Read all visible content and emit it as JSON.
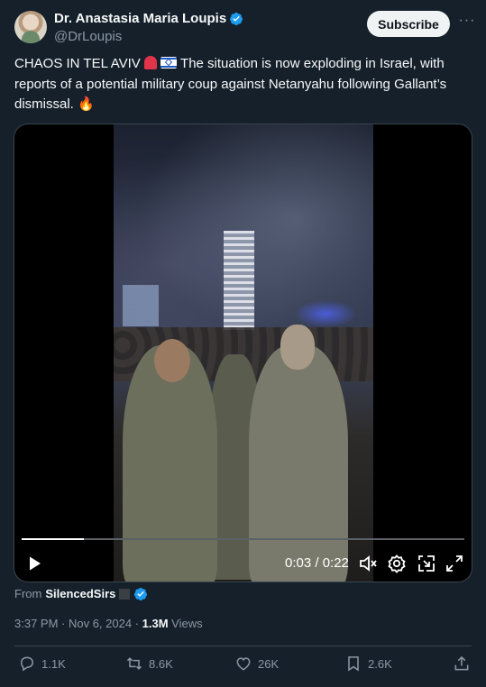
{
  "author": {
    "display_name": "Dr. Anastasia Maria Loupis",
    "handle": "@DrLoupis",
    "verified": true
  },
  "header": {
    "subscribe_label": "Subscribe",
    "more_label": "···"
  },
  "tweet": {
    "text_part1": "CHAOS IN TEL AVIV",
    "text_part2": "The situation is now exploding in Israel, with reports of a potential military coup against Netanyahu following Gallant’s dismissal.",
    "emoji_fire": "🔥"
  },
  "video": {
    "time_label": "0:03 / 0:22",
    "progress": 0.14
  },
  "attribution": {
    "prefix": "From",
    "source": "SilencedSirs"
  },
  "meta": {
    "timestamp": "3:37 PM · Nov 6, 2024 · ",
    "views_count": "1.3M",
    "views_label": " Views"
  },
  "actions": {
    "replies": "1.1K",
    "reposts": "8.6K",
    "likes": "26K",
    "bookmarks": "2.6K"
  },
  "colors": {
    "background": "#15202b",
    "text": "#f7f9f9",
    "muted": "#8b98a5",
    "verified": "#1d9bf0",
    "border": "#38444d"
  },
  "icons": [
    "verified-badge-icon",
    "more-icon",
    "play-icon",
    "volume-icon",
    "settings-icon",
    "pip-icon",
    "fullscreen-icon",
    "reply-icon",
    "repost-icon",
    "like-icon",
    "bookmark-icon",
    "share-icon"
  ]
}
